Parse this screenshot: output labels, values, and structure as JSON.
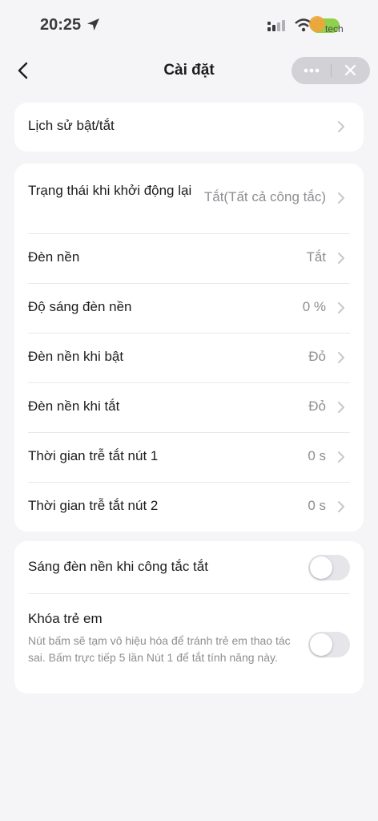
{
  "status_bar": {
    "time": "20:25",
    "brand_text": "tech",
    "icons": [
      "location-arrow-icon",
      "signal-icon",
      "wifi-icon",
      "battery-icon"
    ]
  },
  "nav": {
    "title": "Cài đặt",
    "icons": [
      "chevron-left-icon",
      "more-icon",
      "close-icon"
    ]
  },
  "card1": {
    "rows": [
      {
        "label": "Lịch sử bật/tắt",
        "value": ""
      }
    ]
  },
  "card2": {
    "restart": {
      "label": "Trạng thái khi khởi động lại",
      "value": "Tắt(Tất cả công tắc)"
    },
    "rows": [
      {
        "label": "Đèn nền",
        "value": "Tắt"
      },
      {
        "label": "Độ sáng đèn nền",
        "value": "0 %"
      },
      {
        "label": "Đèn nền khi bật",
        "value": "Đỏ"
      },
      {
        "label": "Đèn nền khi tắt",
        "value": "Đỏ"
      },
      {
        "label": "Thời gian trễ tắt nút 1",
        "value": "0 s"
      },
      {
        "label": "Thời gian trễ tắt nút 2",
        "value": "0 s"
      }
    ]
  },
  "card3": {
    "backlight_off_toggle": {
      "label": "Sáng đèn nền khi công tắc tắt",
      "on": false
    },
    "child_lock": {
      "label": "Khóa trẻ em",
      "description": "Nút bấm sẽ tạm vô hiệu hóa để tránh trẻ em thao tác sai. Bấm trực tiếp 5 lần Nút 1 để tắt tính năng này.",
      "on": false
    }
  },
  "colors": {
    "background": "#f5f5f7",
    "card": "#ffffff",
    "secondary_text": "#8e8e93",
    "toggle_off": "#e5e5ea"
  }
}
